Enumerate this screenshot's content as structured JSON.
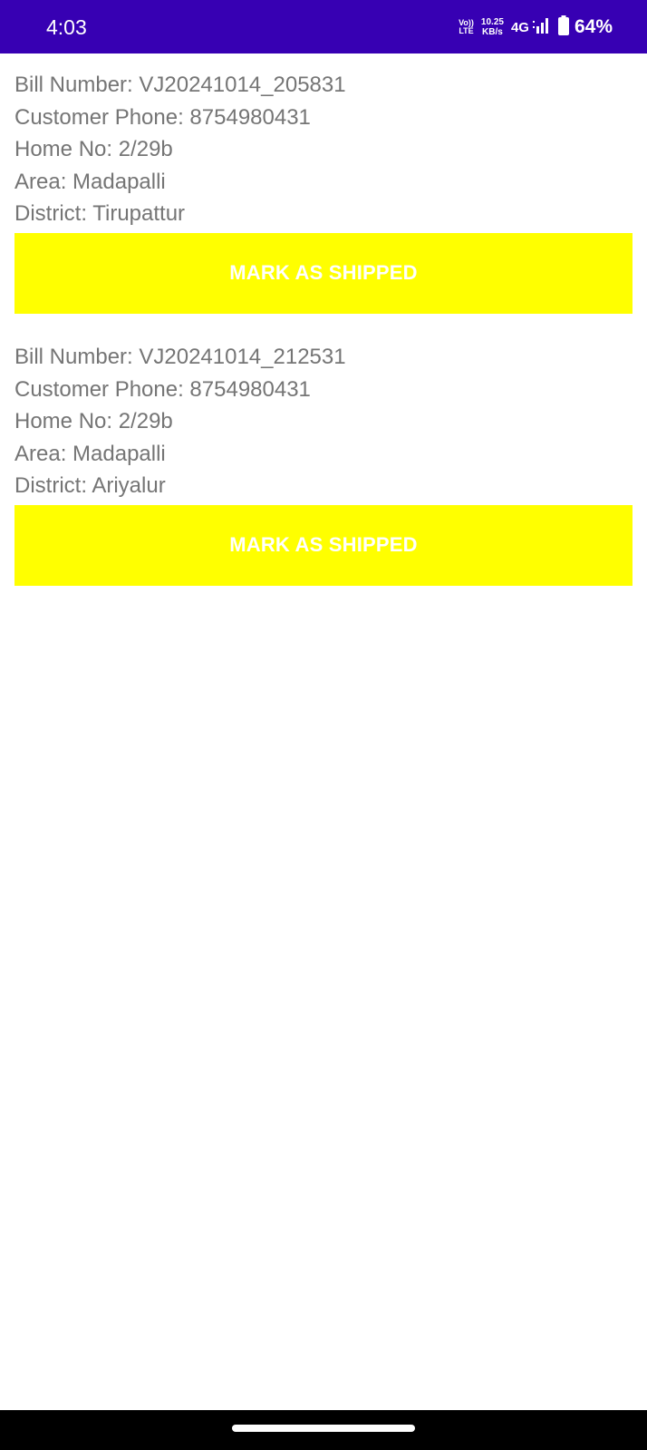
{
  "status_bar": {
    "time": "4:03",
    "volte_top": "Vo))",
    "volte_bottom": "LTE",
    "speed_value": "10.25",
    "speed_unit": "KB/s",
    "network": "4G",
    "battery": "64%",
    "background_color": "#3700b3"
  },
  "orders": [
    {
      "bill_number": "Bill Number: VJ20241014_205831",
      "customer_phone": "Customer Phone: 8754980431",
      "home_no": "Home No: 2/29b",
      "area": "Area: Madapalli",
      "district": "District: Tirupattur",
      "button_label": "MARK AS SHIPPED"
    },
    {
      "bill_number": "Bill Number: VJ20241014_212531",
      "customer_phone": "Customer Phone: 8754980431",
      "home_no": "Home No: 2/29b",
      "area": "Area: Madapalli",
      "district": "District: Ariyalur",
      "button_label": "MARK AS SHIPPED"
    }
  ],
  "colors": {
    "button_background": "#ffff00",
    "button_text": "#ffffff",
    "body_text": "#757575"
  }
}
